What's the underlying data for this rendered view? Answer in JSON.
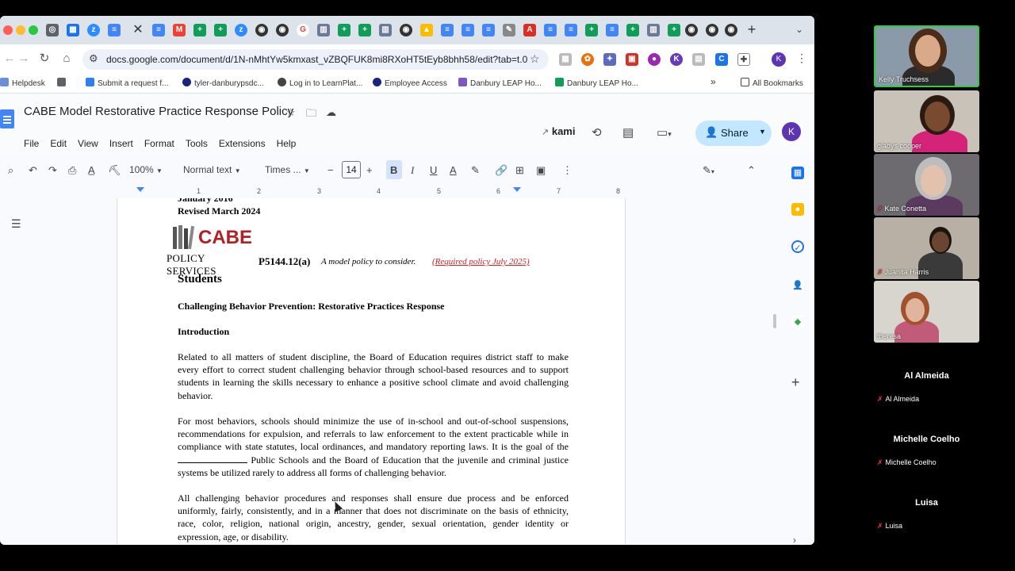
{
  "browser": {
    "url": "docs.google.com/document/d/1N-nMhtYw5kmxast_vZBQFUK8mi8RXoHT5tEyb8bhh58/edit?tab=t.0",
    "bookmarks": [
      {
        "label": "Helpdesk",
        "icon": "apps-grid-icon"
      },
      {
        "label": "Submit a request f...",
        "icon": "request-icon"
      },
      {
        "label": "tyler-danburypsdc...",
        "icon": "circle-icon"
      },
      {
        "label": "Log in to LearnPlat...",
        "icon": "globe-icon"
      },
      {
        "label": "Employee Access",
        "icon": "circle-icon"
      },
      {
        "label": "Danbury LEAP Ho...",
        "icon": "doc-icon"
      },
      {
        "label": "Danbury LEAP Ho...",
        "icon": "sheet-icon"
      },
      {
        "label": "All Bookmarks",
        "icon": "folder-icon"
      }
    ]
  },
  "docs": {
    "title": "CABE Model Restorative Practice Response Policy",
    "menu": [
      "File",
      "Edit",
      "View",
      "Insert",
      "Format",
      "Tools",
      "Extensions",
      "Help"
    ],
    "kami_label": "kami",
    "share_label": "Share",
    "avatar_letter": "K",
    "toolbar": {
      "zoom": "100%",
      "style": "Normal text",
      "font": "Times ...",
      "font_size": "14"
    },
    "ruler_numbers": [
      "1",
      "2",
      "3",
      "4",
      "5",
      "6",
      "7",
      "8"
    ]
  },
  "document": {
    "cut_top_line": "January 2016",
    "revised": "Revised March 2024",
    "logo_word": "CABE",
    "logo_sub": "POLICY SERVICES",
    "policy_number": "P5144.12(a)",
    "policy_note": "A model policy to consider.",
    "policy_required": "(Required policy July 2025)",
    "section": "Students",
    "heading": "Challenging Behavior Prevention: Restorative Practices Response",
    "intro_heading": "Introduction",
    "para1": "Related to all matters of student discipline, the Board of Education requires district staff to make every effort to correct student challenging behavior through school-based resources and to support students in learning the skills necessary to enhance a positive school climate and avoid challenging behavior.",
    "para2_a": "For most behaviors, schools should minimize the use of in-school and out-of-school suspensions, recommendations for expulsion, and referrals to law enforcement to the extent practicable while in compliance with state statutes, local ordinances, and mandatory reporting laws. It is the goal of the",
    "para2_b": "Public Schools and the Board of Education that the juvenile and criminal justice systems be utilized rarely to address all forms of challenging behavior.",
    "para3": "All challenging behavior procedures and responses shall ensure due process and be enforced uniformly, fairly, consistently, and in a manner that does not discriminate on the basis of ethnicity, race, color, religion, national origin, ancestry, gender, sexual orientation, gender identity or expression, age, or disability."
  },
  "participants": {
    "video": [
      {
        "name": "Kelly Truchsess",
        "active": true,
        "bg": "#8a9aa8",
        "skin": "#d9a98a",
        "hair": "#4a2c1a",
        "shirt": "#2b2b2b"
      },
      {
        "name": "gladys cooper",
        "active": false,
        "bg": "#c9c2b8",
        "skin": "#7a4a30",
        "hair": "#2a1a10",
        "shirt": "#d6237a"
      },
      {
        "name": "Kate Conetta",
        "active": false,
        "bg": "#6d6a70",
        "skin": "#e3c2ad",
        "hair": "#bdbdbd",
        "shirt": "#5a3a5e"
      },
      {
        "name": "Juanita Harris",
        "active": false,
        "bg": "#b8b0a4",
        "skin": "#6a4632",
        "hair": "#1e140e",
        "shirt": "#3a3a3a"
      },
      {
        "name": "theresa",
        "active": false,
        "bg": "#d8d4ce",
        "skin": "#e0b59c",
        "hair": "#a0522d",
        "shirt": "#c25a7a"
      }
    ],
    "names_only": [
      "Al Almeida",
      "Michelle Coelho",
      "Luisa"
    ]
  }
}
